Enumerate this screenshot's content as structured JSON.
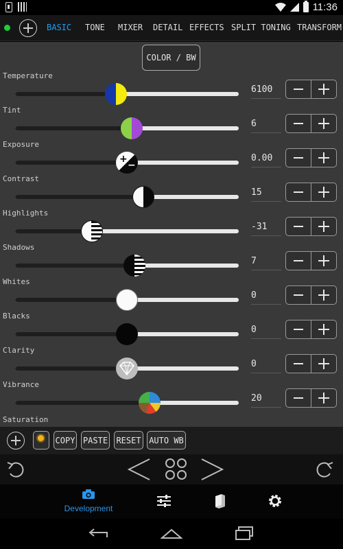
{
  "status_bar": {
    "time": "11:36"
  },
  "tabs": [
    {
      "label": "BASIC",
      "active": true
    },
    {
      "label": "TONE",
      "active": false
    },
    {
      "label": "MIXER",
      "active": false
    },
    {
      "label": "DETAIL",
      "active": false
    },
    {
      "label": "EFFECTS",
      "active": false
    },
    {
      "label": "SPLIT TONING",
      "active": false
    },
    {
      "label": "TRANSFORM",
      "active": false
    }
  ],
  "color_bw_label": "COLOR / BW",
  "sliders": [
    {
      "label": "Temperature",
      "value": "6100",
      "position": 0.45,
      "knob": "temperature-knob"
    },
    {
      "label": "Tint",
      "value": "6",
      "position": 0.52,
      "knob": "tint-knob"
    },
    {
      "label": "Exposure",
      "value": "0.00",
      "position": 0.5,
      "knob": "exposure-knob"
    },
    {
      "label": "Contrast",
      "value": "15",
      "position": 0.575,
      "knob": "contrast-knob"
    },
    {
      "label": "Highlights",
      "value": "-31",
      "position": 0.345,
      "knob": "highlights-knob"
    },
    {
      "label": "Shadows",
      "value": "7",
      "position": 0.535,
      "knob": "shadows-knob"
    },
    {
      "label": "Whites",
      "value": "0",
      "position": 0.5,
      "knob": "whites-knob"
    },
    {
      "label": "Blacks",
      "value": "0",
      "position": 0.5,
      "knob": "blacks-knob"
    },
    {
      "label": "Clarity",
      "value": "0",
      "position": 0.5,
      "knob": "clarity-knob"
    },
    {
      "label": "Vibrance",
      "value": "20",
      "position": 0.6,
      "knob": "vibrance-knob"
    }
  ],
  "partial_slider_label": "Saturation",
  "actions": {
    "copy": "COPY",
    "paste": "PASTE",
    "reset": "RESET",
    "auto_wb": "AUTO WB"
  },
  "bottom_nav": {
    "development": "Development"
  },
  "colors": {
    "accent": "#1e9ff2",
    "indicator": "#1ccf3a",
    "panel": "#393939"
  }
}
